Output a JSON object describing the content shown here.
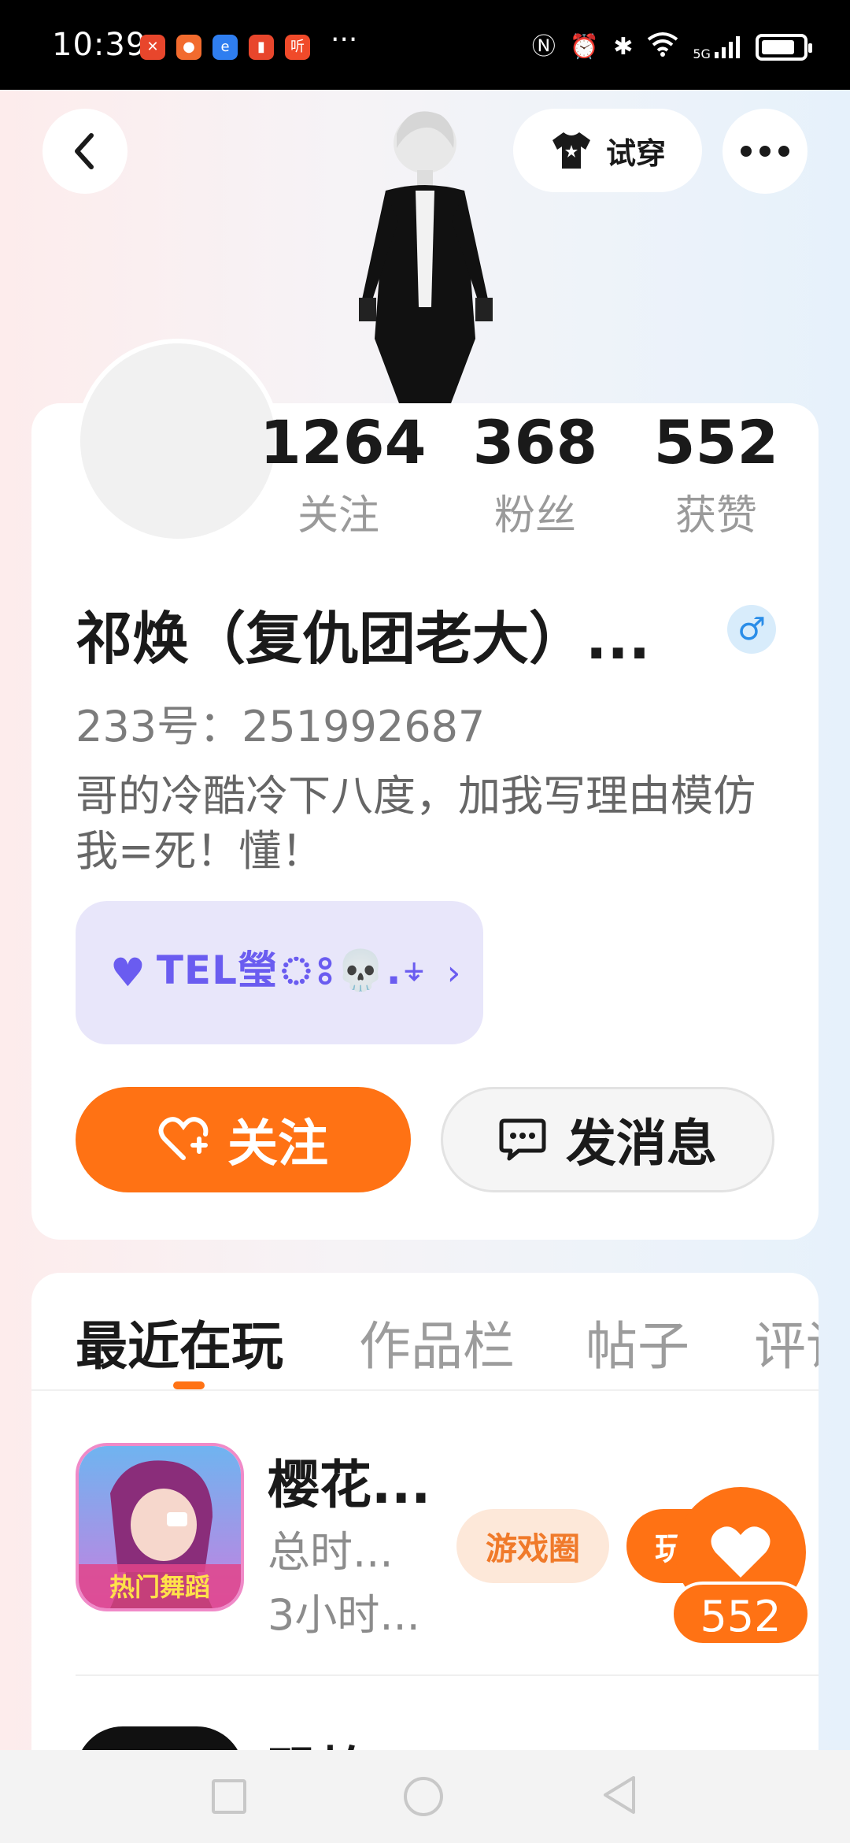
{
  "status_bar": {
    "time": "10:39",
    "more": "···",
    "network": "5G"
  },
  "header": {
    "tryon_label": "试穿"
  },
  "profile": {
    "stats": [
      {
        "value": "1264",
        "label": "关注"
      },
      {
        "value": "368",
        "label": "粉丝"
      },
      {
        "value": "552",
        "label": "获赞"
      }
    ],
    "username": "祁焕（复仇团老大）...",
    "gender_symbol": "♂",
    "uid": "233号：251992687",
    "bio": "哥的冷酷冷下八度，加我写理由模仿我=死！懂！",
    "tag_text": "TEL瑩ঃ💀.⍖",
    "follow_label": "关注",
    "message_label": "发消息"
  },
  "tabs": [
    {
      "label": "最近在玩"
    },
    {
      "label": "作品栏"
    },
    {
      "label": "帖子"
    },
    {
      "label": "评论"
    }
  ],
  "games": [
    {
      "title": "樱花...",
      "sub1": "总时...",
      "sub2": "3小时...",
      "icon_label": "热门舞蹈",
      "circle_label": "游戏圈",
      "play_label": "玩"
    },
    {
      "title": "恐怖"
    }
  ],
  "floating_like": {
    "count": "552"
  },
  "colors": {
    "accent": "#ff7214",
    "tag_bg": "#e8e6fa",
    "tag_text": "#6a5cf0"
  }
}
